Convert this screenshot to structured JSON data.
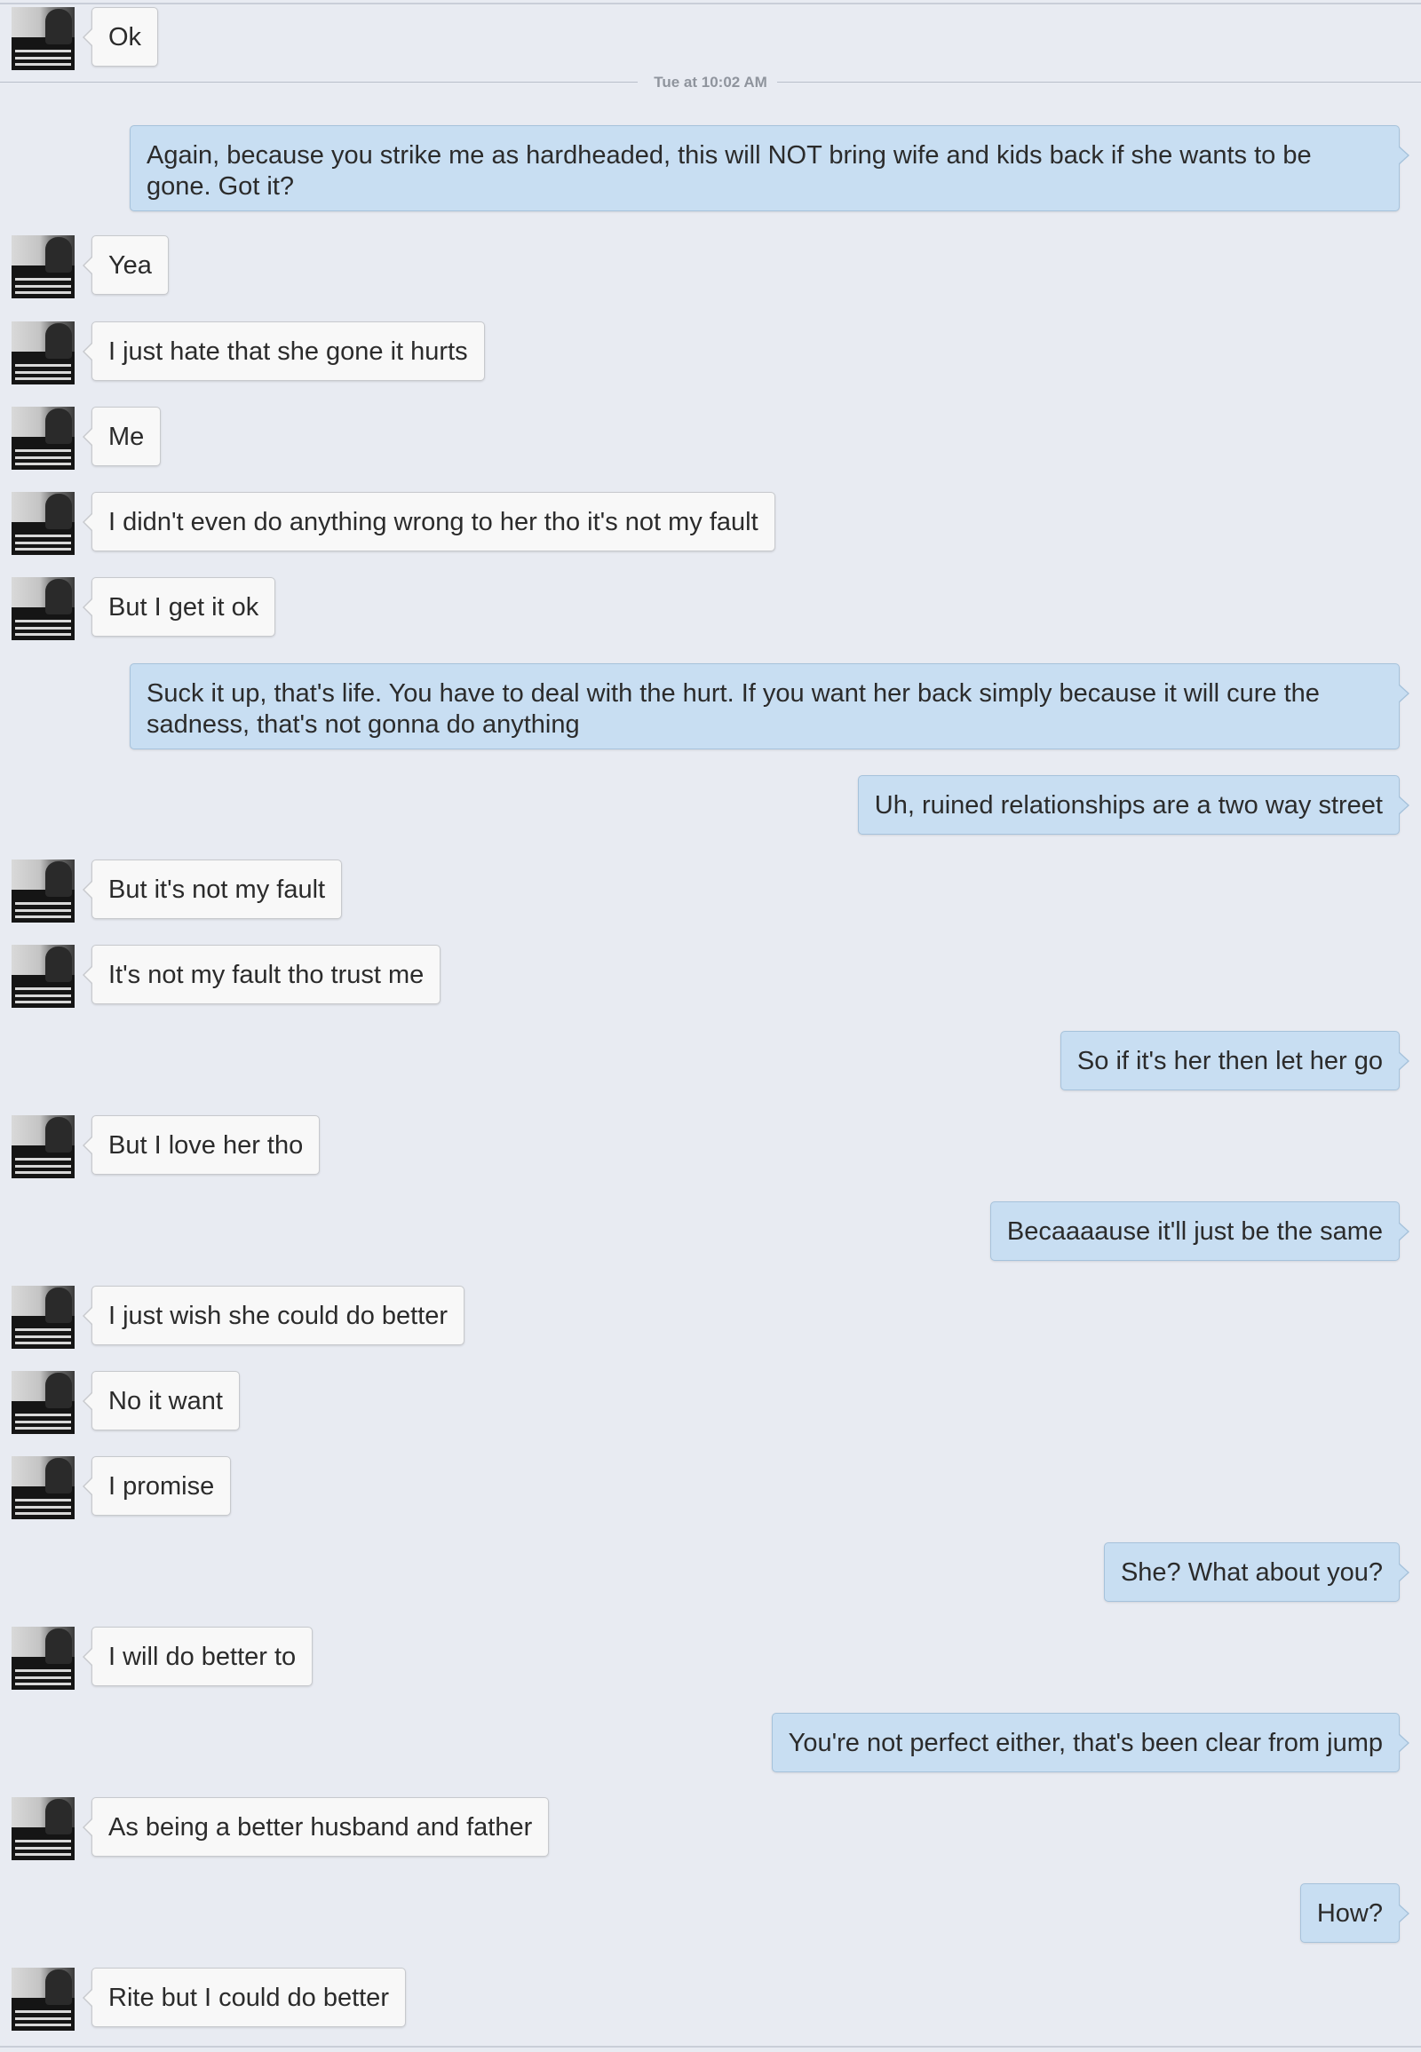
{
  "timestamp": "Tue at 10:02 AM",
  "messages": [
    {
      "from": "contact",
      "text": "Ok"
    },
    {
      "from": "me",
      "text": "Again, because you strike me as hardheaded, this will NOT bring wife and kids back if she wants to be gone. Got it?"
    },
    {
      "from": "contact",
      "text": "Yea"
    },
    {
      "from": "contact",
      "text": "I just hate that she gone it hurts"
    },
    {
      "from": "contact",
      "text": "Me"
    },
    {
      "from": "contact",
      "text": "I didn't even do anything wrong to her tho it's not my fault"
    },
    {
      "from": "contact",
      "text": "But I get it ok"
    },
    {
      "from": "me",
      "text": "Suck it up, that's life. You have to deal with the hurt. If you want her back simply because it will cure the sadness, that's not gonna do anything"
    },
    {
      "from": "me",
      "text": "Uh, ruined relationships are a two way street"
    },
    {
      "from": "contact",
      "text": "But it's not my fault"
    },
    {
      "from": "contact",
      "text": "It's not my fault tho trust me"
    },
    {
      "from": "me",
      "text": "So if it's her then let her go"
    },
    {
      "from": "contact",
      "text": "But I love her tho"
    },
    {
      "from": "me",
      "text": "Becaaaause it'll just be the same"
    },
    {
      "from": "contact",
      "text": "I just wish she could do better"
    },
    {
      "from": "contact",
      "text": "No it want"
    },
    {
      "from": "contact",
      "text": "I promise"
    },
    {
      "from": "me",
      "text": "She? What about you?"
    },
    {
      "from": "contact",
      "text": "I will do better to"
    },
    {
      "from": "me",
      "text": "You're not perfect either, that's been clear from jump"
    },
    {
      "from": "contact",
      "text": "As being a better husband and father"
    },
    {
      "from": "me",
      "text": "How?"
    },
    {
      "from": "contact",
      "text": "Rite but I could do better"
    }
  ]
}
